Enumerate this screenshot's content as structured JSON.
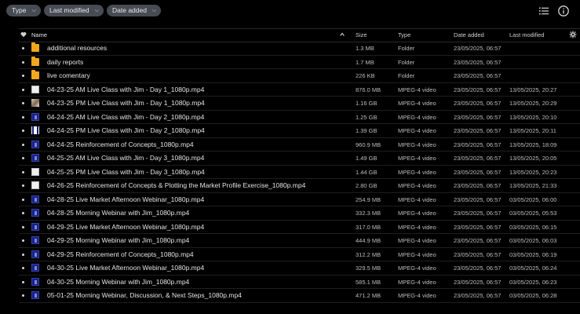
{
  "filters": [
    {
      "label": "Type",
      "active": false
    },
    {
      "label": "Last modified",
      "active": false
    },
    {
      "label": "Date added",
      "active": true
    }
  ],
  "icons": {
    "list_view": "list-view-icon",
    "info": "info-icon",
    "settings": "settings-gear-icon",
    "favorite": "heart-icon",
    "sort": "sort-ascending-icon"
  },
  "columns": {
    "name": "Name",
    "size": "Size",
    "type": "Type",
    "date_added": "Date added",
    "last_modified": "Last modified"
  },
  "files": [
    {
      "icon": "folder",
      "name": "additional resources",
      "size": "1.3 MB",
      "type": "Folder",
      "date_added": "23/05/2025, 06:57",
      "last_modified": ""
    },
    {
      "icon": "folder",
      "name": "daily reports",
      "size": "1.7 MB",
      "type": "Folder",
      "date_added": "23/05/2025, 06:57",
      "last_modified": ""
    },
    {
      "icon": "folder",
      "name": "live comentary",
      "size": "226 KB",
      "type": "Folder",
      "date_added": "23/05/2025, 06:57",
      "last_modified": ""
    },
    {
      "icon": "white",
      "name": "04-23-25 AM Live Class with Jim - Day 1_1080p.mp4",
      "size": "876.0 MB",
      "type": "MPEG-4 video",
      "date_added": "23/05/2025, 06:57",
      "last_modified": "13/05/2025, 20:27"
    },
    {
      "icon": "img",
      "name": "04-23-25 PM Live Class with Jim - Day 1_1080p.mp4",
      "size": "1.16 GB",
      "type": "MPEG-4 video",
      "date_added": "23/05/2025, 06:57",
      "last_modified": "13/05/2025, 20:29"
    },
    {
      "icon": "blue",
      "name": "04-24-25 AM Live Class with Jim - Day 2_1080p.mp4",
      "size": "1.25 GB",
      "type": "MPEG-4 video",
      "date_added": "23/05/2025, 06:57",
      "last_modified": "13/05/2025, 20:10"
    },
    {
      "icon": "bars",
      "name": "04-24-25 PM Live Class with Jim - Day 2_1080p.mp4",
      "size": "1.39 GB",
      "type": "MPEG-4 video",
      "date_added": "23/05/2025, 06:57",
      "last_modified": "13/05/2025, 20:11"
    },
    {
      "icon": "blue",
      "name": "04-24-25 Reinforcement of Concepts_1080p.mp4",
      "size": "960.9 MB",
      "type": "MPEG-4 video",
      "date_added": "23/05/2025, 06:57",
      "last_modified": "13/05/2025, 18:09"
    },
    {
      "icon": "blue",
      "name": "04-25-25 AM Live Class with Jim - Day 3_1080p.mp4",
      "size": "1.49 GB",
      "type": "MPEG-4 video",
      "date_added": "23/05/2025, 06:57",
      "last_modified": "13/05/2025, 20:05"
    },
    {
      "icon": "white",
      "name": "04-25-25 PM Live Class with Jim - Day 3_1080p.mp4",
      "size": "1.44 GB",
      "type": "MPEG-4 video",
      "date_added": "23/05/2025, 06:57",
      "last_modified": "13/05/2025, 20:23"
    },
    {
      "icon": "white",
      "name": "04-26-25 Reinforcement of Concepts & Plotting the Market Profile Exercise_1080p.mp4",
      "size": "2.80 GB",
      "type": "MPEG-4 video",
      "date_added": "23/05/2025, 06:57",
      "last_modified": "13/05/2025, 21:33"
    },
    {
      "icon": "blue",
      "name": "04-28-25 Live Market Afternoon Webinar_1080p.mp4",
      "size": "254.9 MB",
      "type": "MPEG-4 video",
      "date_added": "23/05/2025, 06:57",
      "last_modified": "03/05/2025, 06:00"
    },
    {
      "icon": "blue",
      "name": "04-28-25 Morning Webinar with Jim_1080p.mp4",
      "size": "332.3 MB",
      "type": "MPEG-4 video",
      "date_added": "23/05/2025, 06:57",
      "last_modified": "03/05/2025, 05:53"
    },
    {
      "icon": "blue",
      "name": "04-29-25 Live Market Afternoon Webinar_1080p.mp4",
      "size": "317.0 MB",
      "type": "MPEG-4 video",
      "date_added": "23/05/2025, 06:57",
      "last_modified": "03/05/2025, 06:15"
    },
    {
      "icon": "blue",
      "name": "04-29-25 Morning Webinar with Jim_1080p.mp4",
      "size": "444.9 MB",
      "type": "MPEG-4 video",
      "date_added": "23/05/2025, 06:57",
      "last_modified": "03/05/2025, 06:03"
    },
    {
      "icon": "blue",
      "name": "04-29-25 Reinforcement of Concepts_1080p.mp4",
      "size": "312.2 MB",
      "type": "MPEG-4 video",
      "date_added": "23/05/2025, 06:57",
      "last_modified": "03/05/2025, 06:19"
    },
    {
      "icon": "blue",
      "name": "04-30-25 Live Market Afternoon Webinar_1080p.mp4",
      "size": "329.5 MB",
      "type": "MPEG-4 video",
      "date_added": "23/05/2025, 06:57",
      "last_modified": "03/05/2025, 06:24"
    },
    {
      "icon": "blue",
      "name": "04-30-25 Morning Webinar with Jim_1080p.mp4",
      "size": "585.1 MB",
      "type": "MPEG-4 video",
      "date_added": "23/05/2025, 06:57",
      "last_modified": "03/05/2025, 06:23"
    },
    {
      "icon": "blue",
      "name": "05-01-25 Morning Webinar, Discussion, & Next Steps_1080p.mp4",
      "size": "471.2 MB",
      "type": "MPEG-4 video",
      "date_added": "23/05/2025, 06:57",
      "last_modified": "03/05/2025, 06:28"
    }
  ]
}
